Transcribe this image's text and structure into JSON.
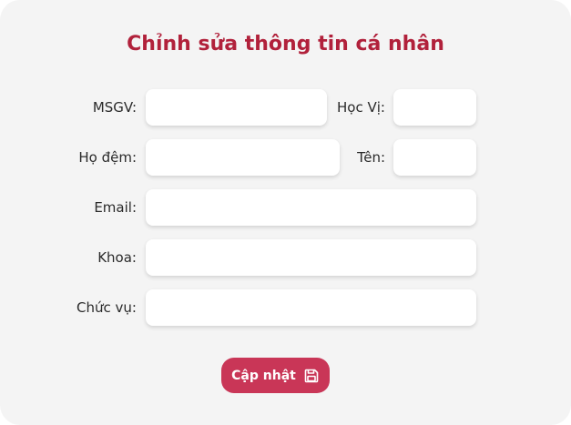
{
  "form": {
    "title": "Chỉnh sửa thông tin cá nhân",
    "fields": {
      "msgv": {
        "label": "MSGV:",
        "value": "",
        "placeholder": ""
      },
      "hoc_vi": {
        "label": "Học Vị:",
        "value": "",
        "placeholder": ""
      },
      "ho_dem": {
        "label": "Họ đệm:",
        "value": "",
        "placeholder": ""
      },
      "ten": {
        "label": "Tên:",
        "value": "",
        "placeholder": ""
      },
      "email": {
        "label": "Email:",
        "value": "",
        "placeholder": ""
      },
      "khoa": {
        "label": "Khoa:",
        "value": "",
        "placeholder": ""
      },
      "chuc_vu": {
        "label": "Chức vụ:",
        "value": "",
        "placeholder": ""
      }
    },
    "submit": {
      "label": "Cập nhật",
      "icon": "save-icon"
    }
  },
  "colors": {
    "title": "#b1213b",
    "button": "#c93657",
    "background": "#f4f4f4"
  }
}
